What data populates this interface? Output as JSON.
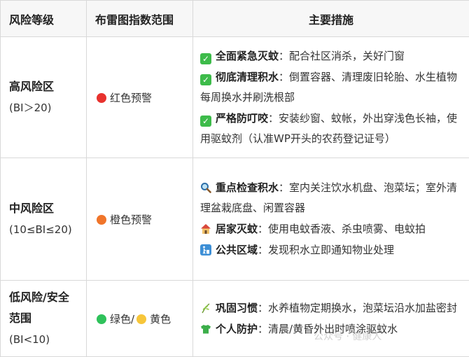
{
  "header": {
    "col1": "风险等级",
    "col2": "布雷图指数范围",
    "col3": "主要措施"
  },
  "rows": [
    {
      "level_name": "高风险区",
      "level_range": "(BI＞20)",
      "warning_label": "红色预警",
      "warning_color": "#e8322e",
      "measures": [
        {
          "icon": "check-box-icon",
          "title": "全面紧急灭蚊",
          "sep": "：",
          "text": "配合社区消杀，关好门窗"
        },
        {
          "icon": "check-box-icon",
          "title": "彻底清理积水",
          "sep": "：",
          "text": "倒置容器、清理废旧轮胎、水生植物每周换水并刷洗根部"
        },
        {
          "icon": "check-box-icon",
          "title": "严格防叮咬",
          "sep": "：",
          "text": "安装纱窗、蚊帐，外出穿浅色长袖，使用驱蚊剂（认准WP开头的农药登记证号）"
        }
      ]
    },
    {
      "level_name": "中风险区",
      "level_range": "(10≤BI≤20)",
      "warning_label": "橙色预警",
      "warning_color": "#f0752a",
      "measures": [
        {
          "icon": "magnifier-icon",
          "title": "重点检查积水",
          "sep": "：",
          "text": "室内关注饮水机盘、泡菜坛；室外清理盆栽底盘、闲置容器"
        },
        {
          "icon": "house-icon",
          "title": "居家灭蚊",
          "sep": "：",
          "text": "使用电蚊香液、杀虫喷雾、电蚊拍"
        },
        {
          "icon": "trash-bin-icon",
          "title": "公共区域",
          "sep": "：",
          "text": "发现积水立即通知物业处理"
        }
      ]
    },
    {
      "level_name": "低风险/安全范围",
      "level_range": "(BI<10)",
      "warning_label_a": "绿色/",
      "warning_label_b": "黄色",
      "warning_color": "#2fc25b",
      "warning_color_b": "#f7c63a",
      "measures": [
        {
          "icon": "herb-icon",
          "title": "巩固习惯",
          "sep": "：",
          "text": "水养植物定期换水，泡菜坛沿水加盐密封"
        },
        {
          "icon": "t-shirt-icon",
          "title": "个人防护",
          "sep": "：",
          "text": "清晨/黄昏外出时喷涂驱蚊水"
        }
      ]
    }
  ],
  "watermark": "公众号 · 健康人"
}
